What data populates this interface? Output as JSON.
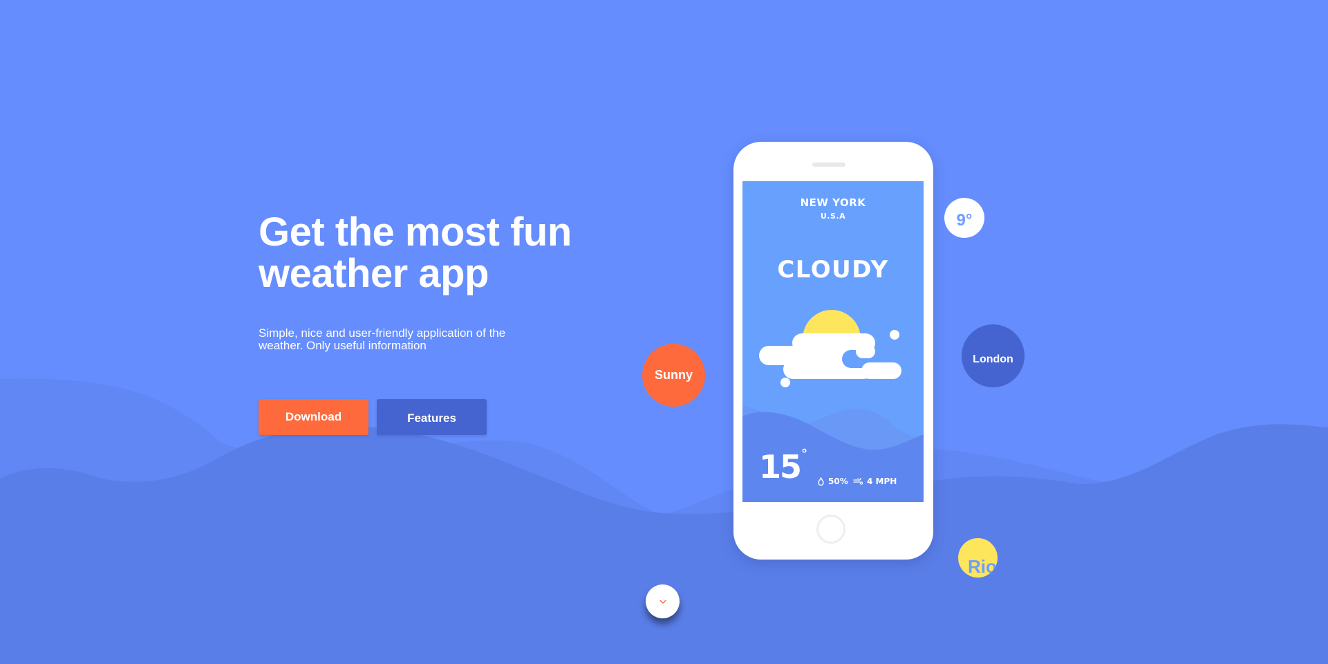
{
  "hero": {
    "headline_line1": "Get the most fun",
    "headline_line2": "weather app",
    "subtitle_line1": "Simple, nice and user-friendly application of the",
    "subtitle_line2": "weather. Only useful information",
    "download_label": "Download",
    "features_label": "Features"
  },
  "phone": {
    "city": "NEW YORK",
    "country": "U.S.A",
    "condition": "CLOUDY",
    "temperature": "15",
    "degree_symbol": "°",
    "humidity": "50%",
    "wind": "4 MPH"
  },
  "bubbles": {
    "sunny": "Sunny",
    "temp": "9°",
    "london": "London",
    "rio": "Rio"
  },
  "icons": {
    "humidity": "droplet-icon",
    "wind": "wind-icon",
    "scroll": "chevron-down-icon"
  },
  "colors": {
    "background": "#658dfd",
    "accent_orange": "#ff6a3d",
    "accent_dark_blue": "#4564d0",
    "accent_yellow": "#fde55c",
    "screen_blue": "#68a0fe"
  }
}
